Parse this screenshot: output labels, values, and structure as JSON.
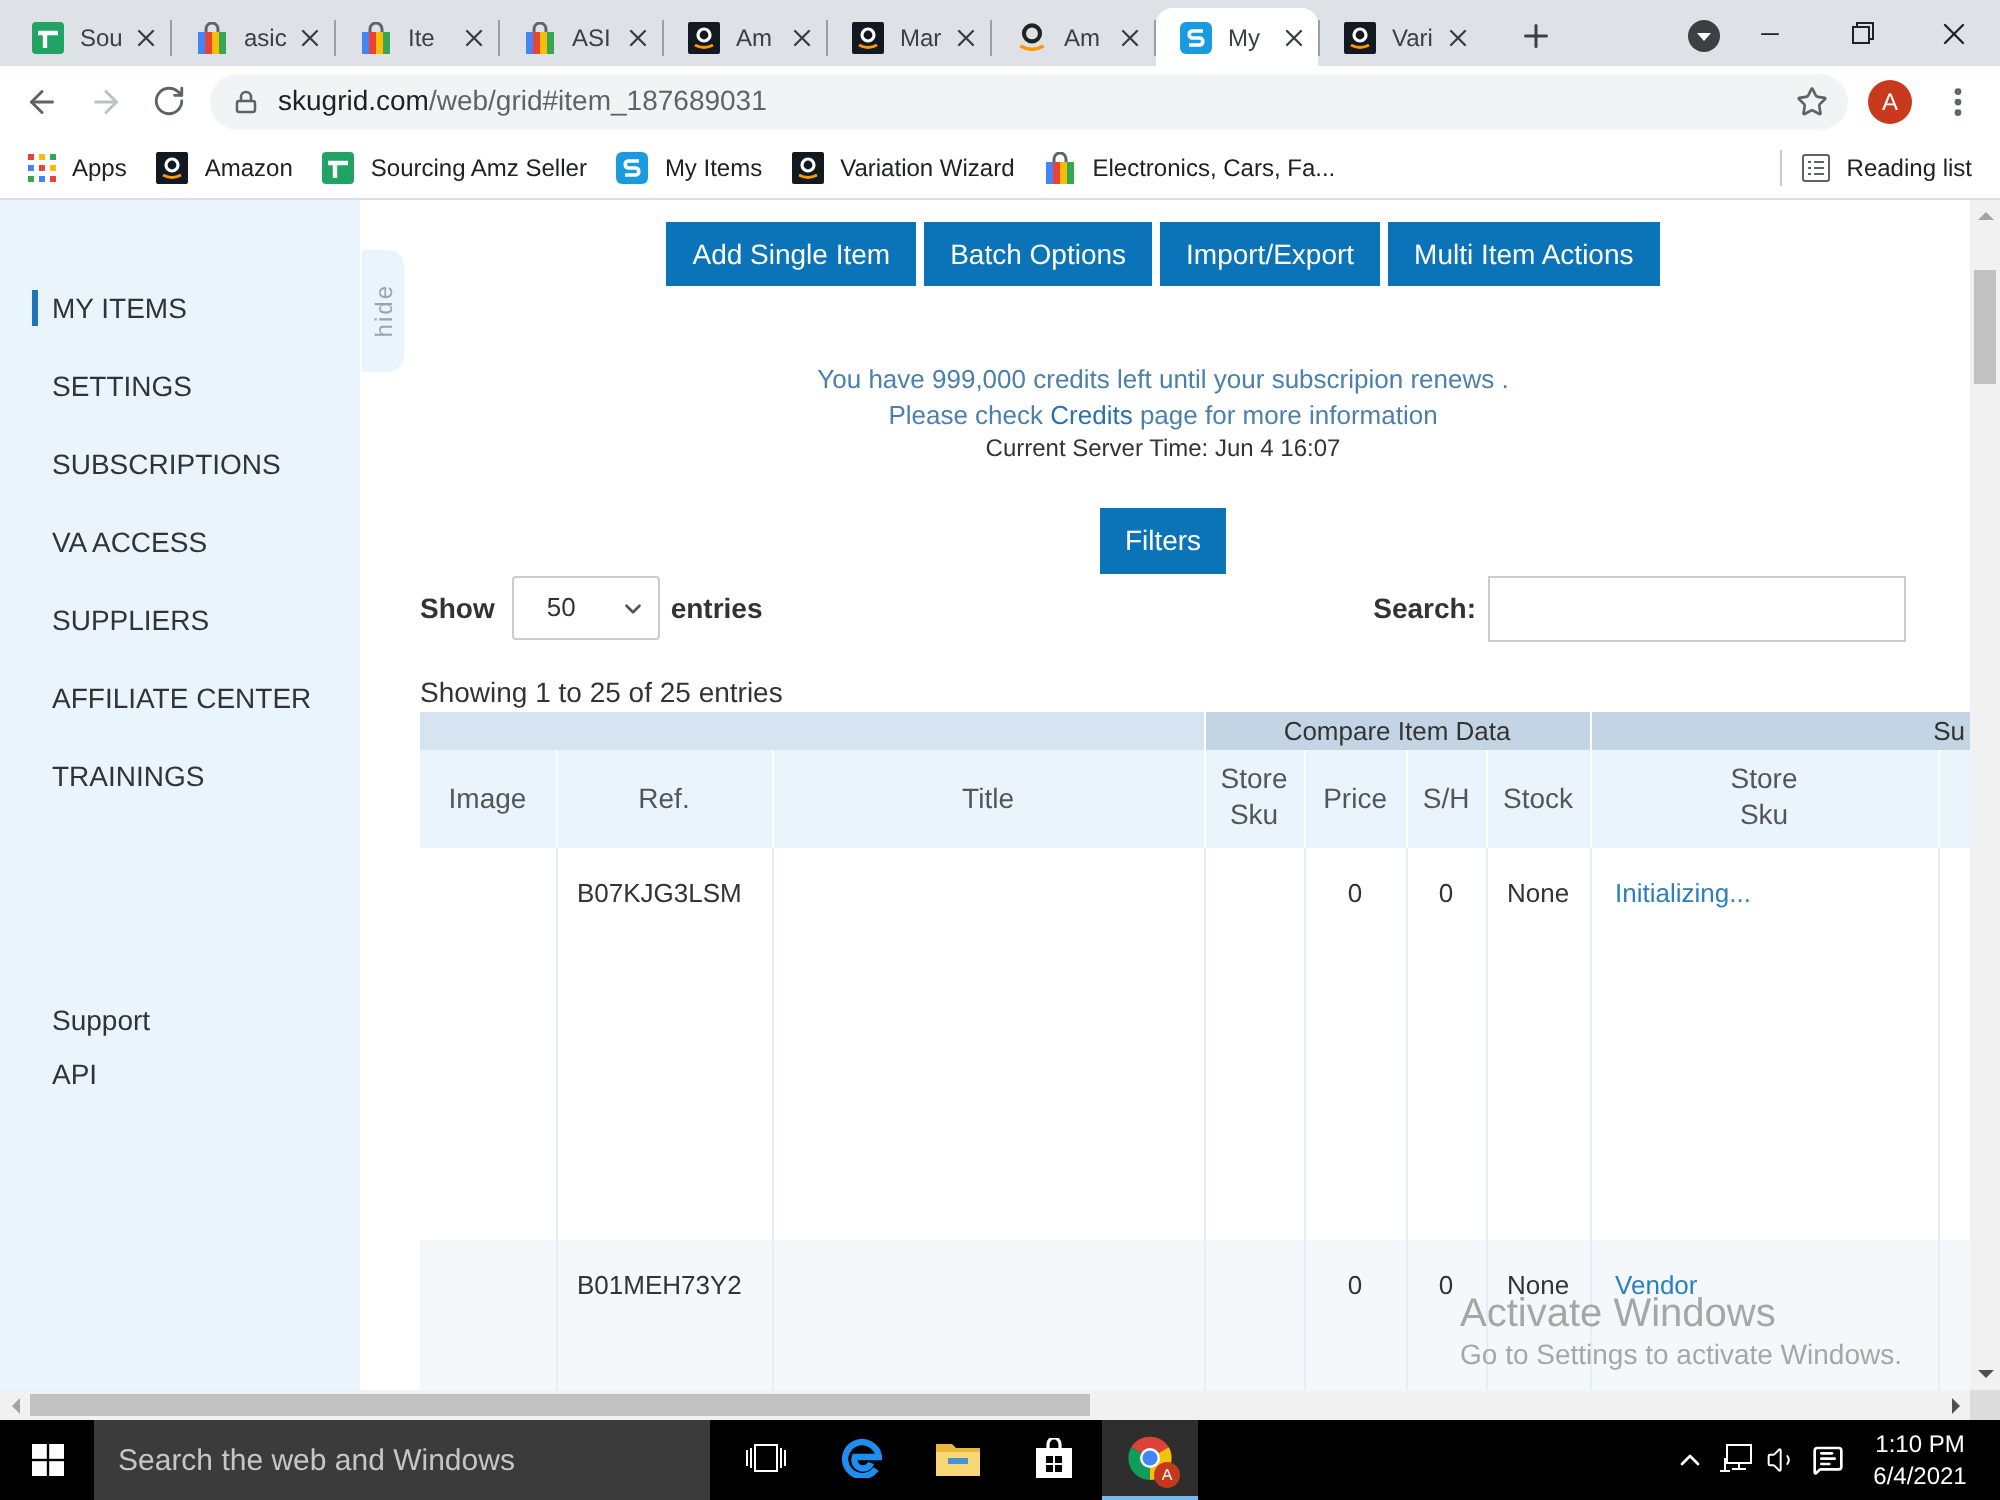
{
  "browser": {
    "tabs": [
      {
        "kind": "sheet",
        "title": "Sou",
        "selected": false
      },
      {
        "kind": "bag",
        "title": "asic",
        "selected": false
      },
      {
        "kind": "bag",
        "title": "Ite",
        "selected": false
      },
      {
        "kind": "bag",
        "title": "ASI",
        "selected": false
      },
      {
        "kind": "amazon",
        "title": "Am",
        "selected": false
      },
      {
        "kind": "amazon",
        "title": "Mar",
        "selected": false
      },
      {
        "kind": "smile",
        "title": "Am",
        "selected": false
      },
      {
        "kind": "skugrid",
        "title": "My",
        "selected": true
      },
      {
        "kind": "amazon",
        "title": "Vari",
        "selected": false
      }
    ],
    "address": {
      "host": "skugrid.com",
      "path": "/web/grid#item_187689031"
    },
    "avatar": "A",
    "bookmarks": [
      {
        "kind": "apps",
        "label": "Apps"
      },
      {
        "kind": "amazon",
        "label": "Amazon"
      },
      {
        "kind": "sheet",
        "label": "Sourcing Amz Seller"
      },
      {
        "kind": "skugrid",
        "label": "My Items"
      },
      {
        "kind": "amazon",
        "label": "Variation Wizard"
      },
      {
        "kind": "bag",
        "label": "Electronics, Cars, Fa..."
      }
    ],
    "reading_list": "Reading list"
  },
  "sidebar": {
    "items": [
      {
        "label": "MY ITEMS",
        "selected": true
      },
      {
        "label": "SETTINGS",
        "selected": false
      },
      {
        "label": "SUBSCRIPTIONS",
        "selected": false
      },
      {
        "label": "VA ACCESS",
        "selected": false
      },
      {
        "label": "SUPPLIERS",
        "selected": false
      },
      {
        "label": "AFFILIATE CENTER",
        "selected": false
      },
      {
        "label": "TRAININGS",
        "selected": false
      }
    ],
    "links": [
      "Support",
      "API"
    ],
    "hide_tab": "hide"
  },
  "toolbar": {
    "buttons": [
      "Add Single Item",
      "Batch Options",
      "Import/Export",
      "Multi Item Actions"
    ]
  },
  "notice": {
    "credits": "You have 999,000 credits left until your subscripion renews .",
    "check_before": "Please check",
    "check_link": "Credits",
    "check_after": "page for more information",
    "server_time": "Current Server Time: Jun 4 16:07"
  },
  "filters_button": "Filters",
  "length_menu": {
    "before": "Show",
    "value": "50",
    "after": "entries"
  },
  "search": {
    "label": "Search:"
  },
  "table_info": "Showing 1 to 25 of 25 entries",
  "table": {
    "groups": [
      {
        "columns": [
          "Image",
          "Ref.",
          "Title"
        ]
      },
      {
        "label": "Compare Item Data",
        "columns": [
          "Store Sku",
          "Price",
          "S/H",
          "Stock"
        ]
      },
      {
        "label": "Su",
        "columns": [
          "Store Sku"
        ]
      }
    ],
    "rows": [
      {
        "ref": "B07KJG3LSM",
        "price": "0",
        "s_h": "0",
        "stock": "None",
        "column_8": "Initializing..."
      },
      {
        "ref": "B01MEH73Y2",
        "price": "0",
        "s_h": "0",
        "stock": "None",
        "column_8": "Vendor"
      }
    ]
  },
  "os_notice": {
    "title": "Activate Windows",
    "text": "Go to Settings to activate Windows."
  },
  "taskbar": {
    "search_placeholder": "Search the web and Windows",
    "apps": [
      {
        "kind": "taskview",
        "selected": false
      },
      {
        "kind": "edge",
        "selected": false
      },
      {
        "kind": "folder",
        "selected": false
      },
      {
        "kind": "store",
        "selected": false
      },
      {
        "kind": "chrome",
        "selected": true,
        "badge": "A"
      }
    ],
    "time": "1:10 PM",
    "date": "6/4/2021"
  }
}
